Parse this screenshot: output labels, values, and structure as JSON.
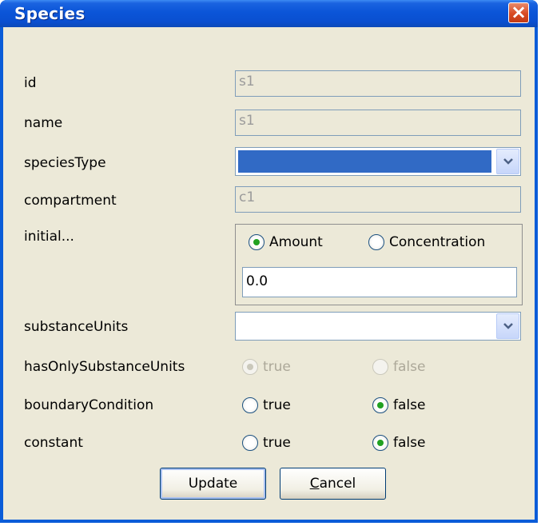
{
  "window": {
    "title": "Species"
  },
  "fields": {
    "id": {
      "label": "id",
      "value": "s1"
    },
    "name": {
      "label": "name",
      "value": "s1"
    },
    "speciesType": {
      "label": "speciesType",
      "value": ""
    },
    "compartment": {
      "label": "compartment",
      "value": "c1"
    },
    "initial": {
      "label": "initial...",
      "options": [
        "Amount",
        "Concentration"
      ],
      "selected": "Amount",
      "value": "0.0"
    },
    "substanceUnits": {
      "label": "substanceUnits",
      "value": ""
    },
    "hasOnlySubstanceUnits": {
      "label": "hasOnlySubstanceUnits",
      "true_label": "true",
      "false_label": "false",
      "selected": "true",
      "enabled": false
    },
    "boundaryCondition": {
      "label": "boundaryCondition",
      "true_label": "true",
      "false_label": "false",
      "selected": "false"
    },
    "constant": {
      "label": "constant",
      "true_label": "true",
      "false_label": "false",
      "selected": "false"
    }
  },
  "buttons": {
    "update": "Update",
    "cancel_mnemonic": "C",
    "cancel_rest": "ancel"
  },
  "icons": [
    "close-icon",
    "chevron-down-icon",
    "radio-icon"
  ],
  "colors": {
    "titlebar": "#0a5cd8",
    "selection": "#316ac5",
    "client": "#ece9d8",
    "radio_dot": "#21a121"
  }
}
